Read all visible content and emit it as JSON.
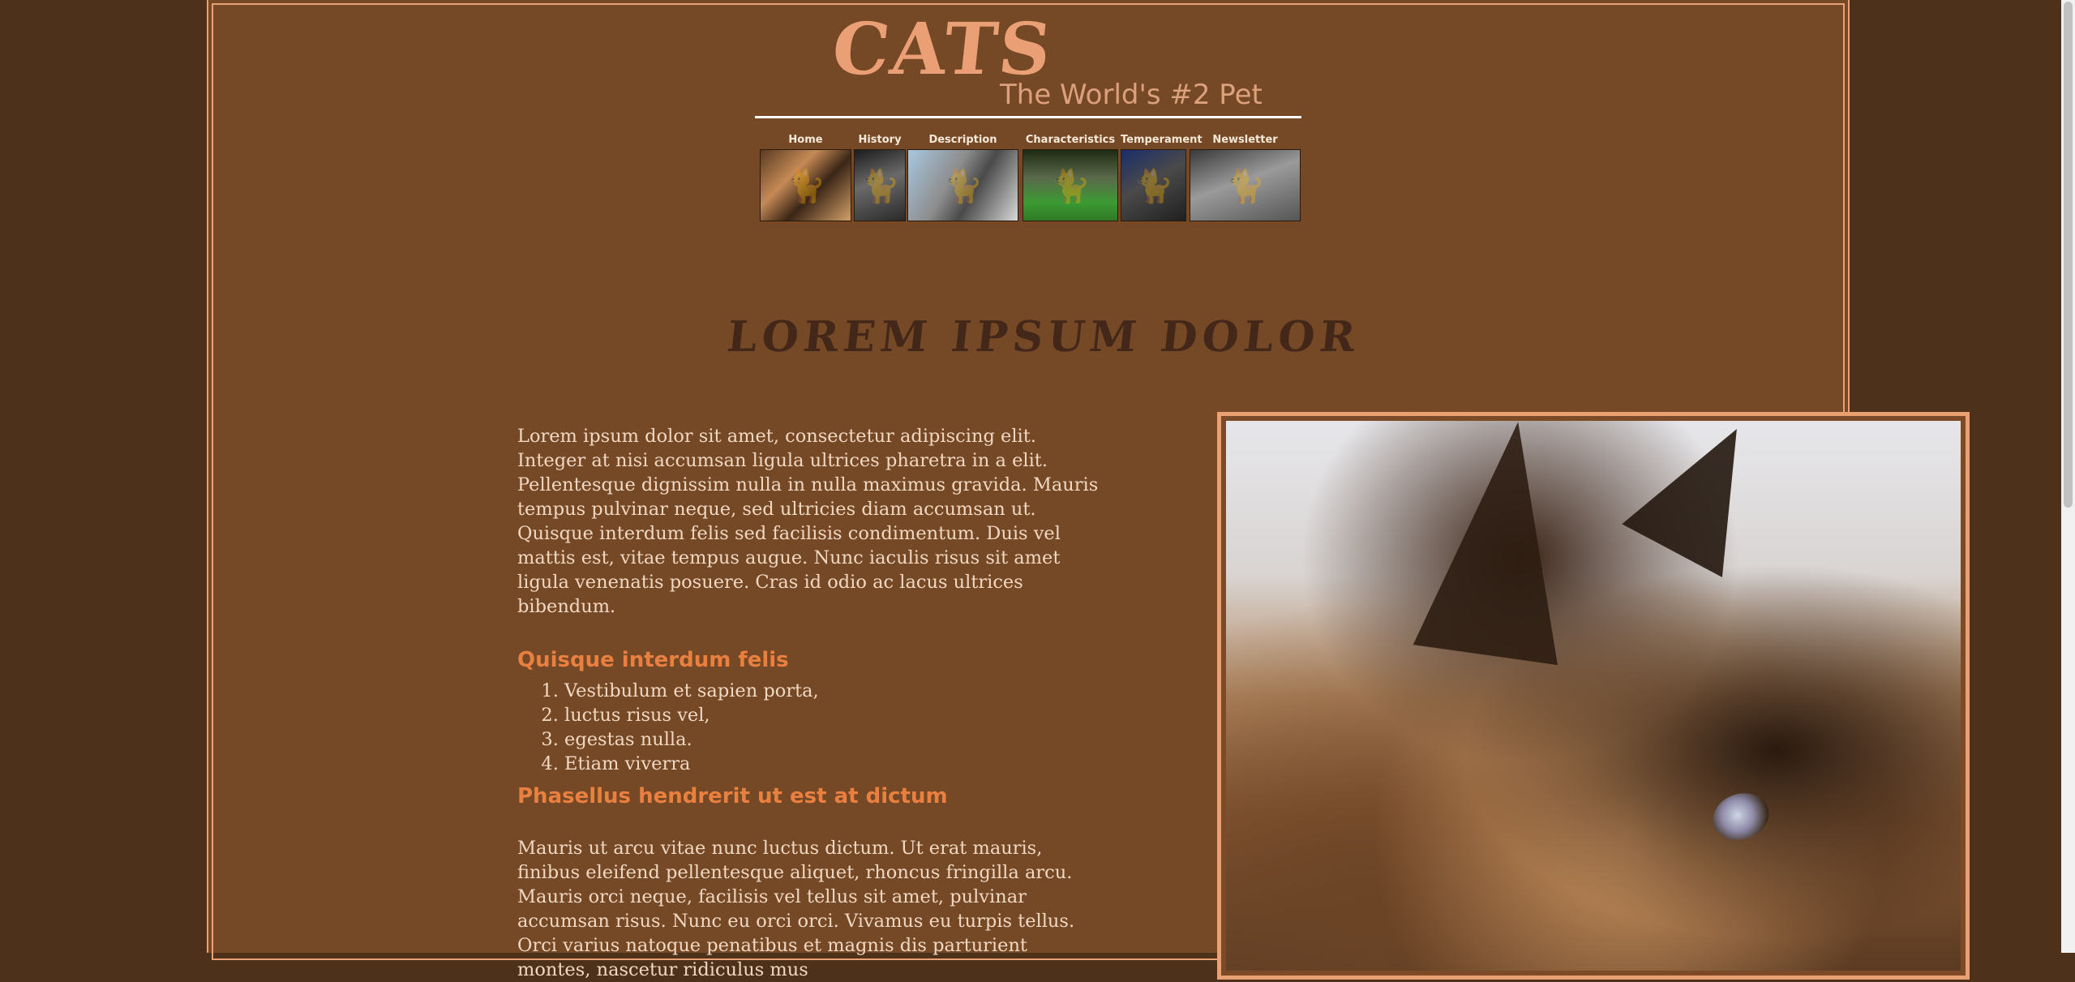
{
  "header": {
    "logo_title": "CATS",
    "tagline": "The World's #2 Pet"
  },
  "nav": {
    "items": [
      {
        "label": "Home"
      },
      {
        "label": "History"
      },
      {
        "label": "Description"
      },
      {
        "label": "Characteristics"
      },
      {
        "label": "Temperament"
      },
      {
        "label": "Newsletter"
      }
    ]
  },
  "main": {
    "heading": "LOREM IPSUM DOLOR",
    "intro": "Lorem ipsum dolor sit amet, consectetur adipiscing elit. Integer at nisi accumsan ligula ultrices pharetra in a elit. Pellentesque dignissim nulla in nulla maximus gravida. Mauris tempus pulvinar neque, sed ultricies diam accumsan ut. Quisque interdum felis sed facilisis condimentum. Duis vel mattis est, vitae tempus augue. Nunc iaculis risus sit amet ligula venenatis posuere. Cras id odio ac lacus ultrices bibendum.",
    "subheading_1": "Quisque interdum felis",
    "list": [
      "Vestibulum et sapien porta,",
      "luctus risus vel,",
      "egestas nulla.",
      "Etiam viverra"
    ],
    "subheading_2": "Phasellus hendrerit ut est at dictum",
    "paragraph_2": "Mauris ut arcu vitae nunc luctus dictum. Ut erat mauris, finibus eleifend pellentesque aliquet, rhoncus fringilla arcu. Mauris orci neque, facilisis vel tellus sit amet, pulvinar accumsan risus. Nunc eu orci orci. Vivamus eu turpis tellus. Orci varius natoque penatibus et magnis dis parturient montes, nascetur ridiculus mus"
  },
  "colors": {
    "page_bg": "#4e311a",
    "content_bg": "#754826",
    "accent": "#e9a173",
    "subheading": "#ea8040",
    "body_text": "#f1d8c2",
    "heading_text": "#43281a"
  },
  "icons": {
    "thumbnail_placeholder": "cat-photo"
  }
}
